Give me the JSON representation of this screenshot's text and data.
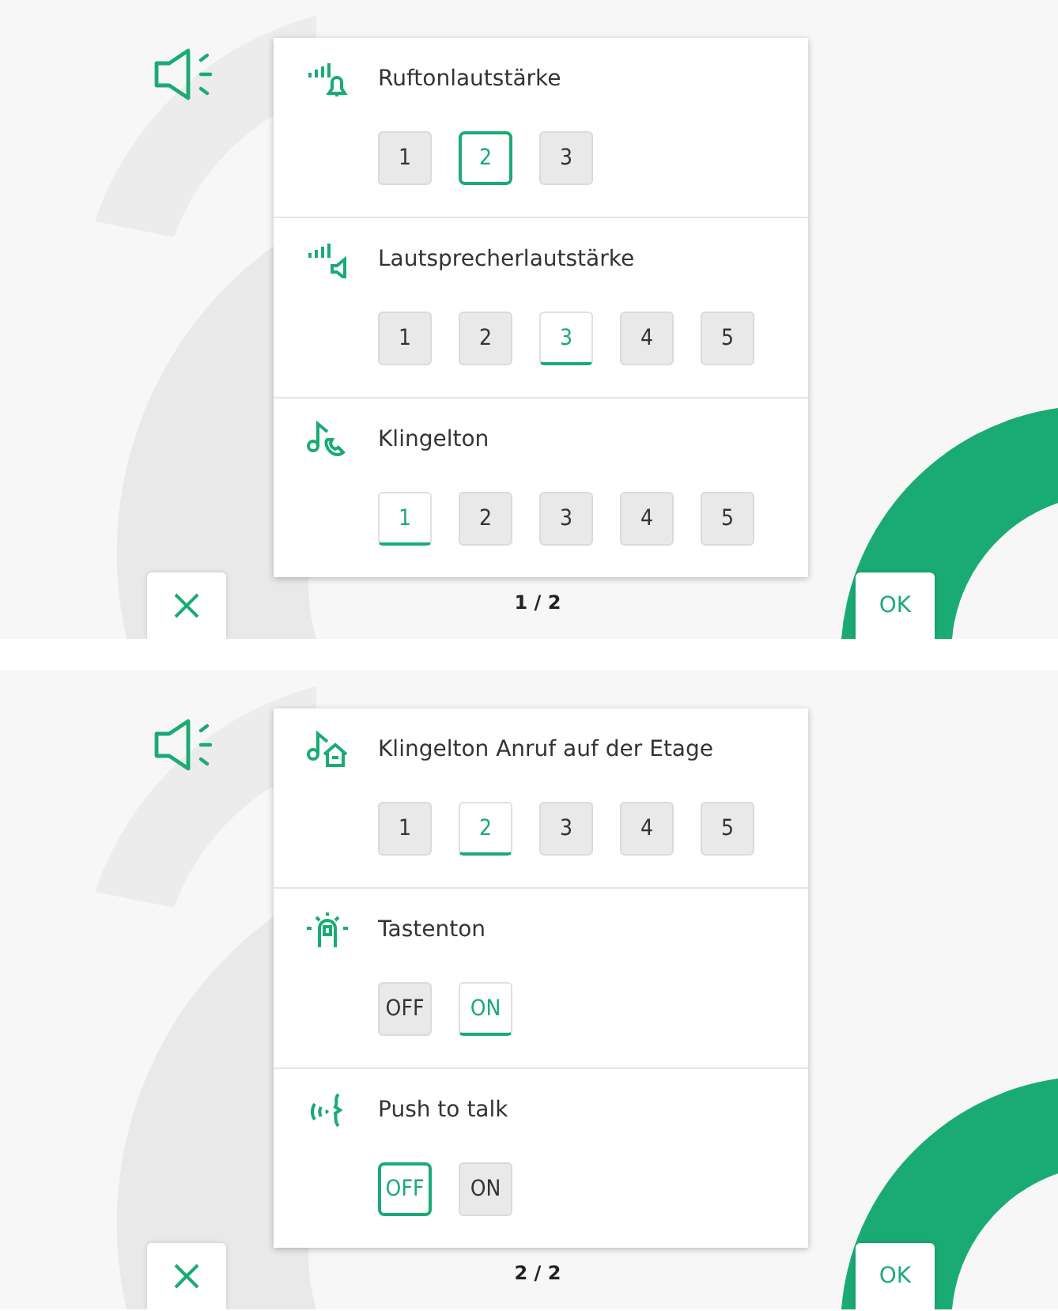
{
  "screens": [
    {
      "sections": [
        {
          "label": "Ruftonlautstärke",
          "options": [
            {
              "label": "1",
              "selected": false,
              "focused": false
            },
            {
              "label": "2",
              "selected": true,
              "focused": true
            },
            {
              "label": "3",
              "selected": false,
              "focused": false
            }
          ]
        },
        {
          "label": "Lautsprecherlautstärke",
          "options": [
            {
              "label": "1",
              "selected": false,
              "focused": false
            },
            {
              "label": "2",
              "selected": false,
              "focused": false
            },
            {
              "label": "3",
              "selected": true,
              "focused": false
            },
            {
              "label": "4",
              "selected": false,
              "focused": false
            },
            {
              "label": "5",
              "selected": false,
              "focused": false
            }
          ]
        },
        {
          "label": "Klingelton",
          "options": [
            {
              "label": "1",
              "selected": true,
              "focused": false
            },
            {
              "label": "2",
              "selected": false,
              "focused": false
            },
            {
              "label": "3",
              "selected": false,
              "focused": false
            },
            {
              "label": "4",
              "selected": false,
              "focused": false
            },
            {
              "label": "5",
              "selected": false,
              "focused": false
            }
          ]
        }
      ],
      "page": "1 / 2",
      "ok": "OK"
    },
    {
      "sections": [
        {
          "label": "Klingelton Anruf auf der Etage",
          "options": [
            {
              "label": "1",
              "selected": false,
              "focused": false
            },
            {
              "label": "2",
              "selected": true,
              "focused": false
            },
            {
              "label": "3",
              "selected": false,
              "focused": false
            },
            {
              "label": "4",
              "selected": false,
              "focused": false
            },
            {
              "label": "5",
              "selected": false,
              "focused": false
            }
          ]
        },
        {
          "label": "Tastenton",
          "options": [
            {
              "label": "OFF",
              "selected": false,
              "focused": false
            },
            {
              "label": "ON",
              "selected": true,
              "focused": false
            }
          ]
        },
        {
          "label": "Push to talk",
          "options": [
            {
              "label": "OFF",
              "selected": true,
              "focused": true
            },
            {
              "label": "ON",
              "selected": false,
              "focused": false
            }
          ]
        }
      ],
      "page": "2 / 2",
      "ok": "OK"
    }
  ]
}
